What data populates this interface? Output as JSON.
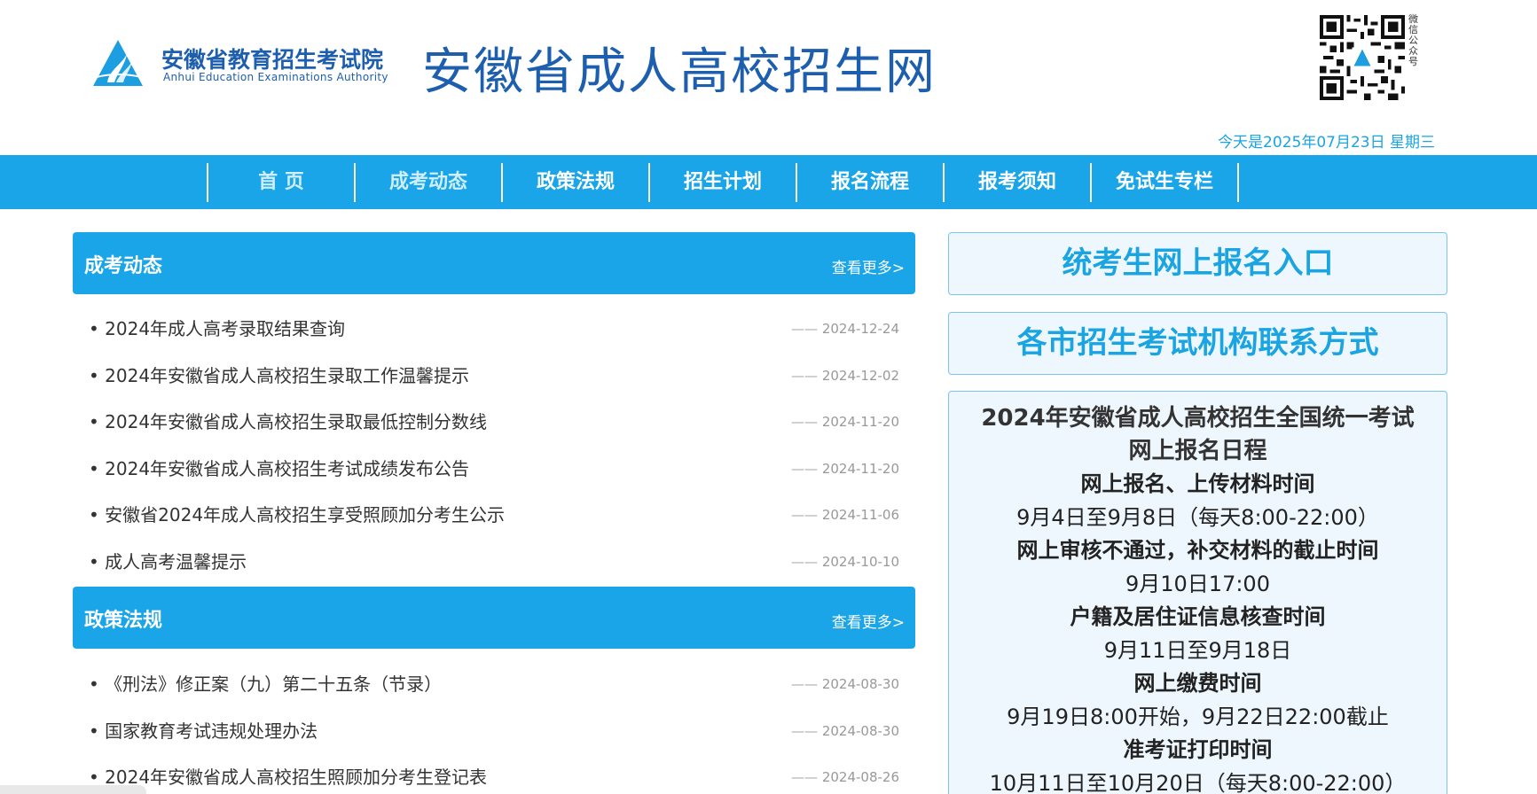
{
  "header": {
    "org_name_cn": "安徽省教育招生考试院",
    "org_name_en": "Anhui Education Examinations Authority",
    "site_title": "安徽省成人高校招生网",
    "qr_label": "微信公众号",
    "date_text": "今天是2025年07月23日 星期三"
  },
  "nav": {
    "items": [
      {
        "label": "首 页"
      },
      {
        "label": "成考动态"
      },
      {
        "label": "政策法规"
      },
      {
        "label": "招生计划"
      },
      {
        "label": "报名流程"
      },
      {
        "label": "报考须知"
      },
      {
        "label": "免试生专栏"
      }
    ]
  },
  "news_section": {
    "title": "成考动态",
    "more": "查看更多>",
    "items": [
      {
        "title": "2024年成人高考录取结果查询",
        "date": "2024-12-24"
      },
      {
        "title": "2024年安徽省成人高校招生录取工作温馨提示",
        "date": "2024-12-02"
      },
      {
        "title": "2024年安徽省成人高校招生录取最低控制分数线",
        "date": "2024-11-20"
      },
      {
        "title": "2024年安徽省成人高校招生考试成绩发布公告",
        "date": "2024-11-20"
      },
      {
        "title": "安徽省2024年成人高校招生享受照顾加分考生公示",
        "date": "2024-11-06"
      },
      {
        "title": "成人高考温馨提示",
        "date": "2024-10-10"
      }
    ]
  },
  "policy_section": {
    "title": "政策法规",
    "more": "查看更多>",
    "items": [
      {
        "title": "《刑法》修正案（九）第二十五条（节录）",
        "date": "2024-08-30"
      },
      {
        "title": "国家教育考试违规处理办法",
        "date": "2024-08-30"
      },
      {
        "title": "2024年安徽省成人高校招生照顾加分考生登记表",
        "date": "2024-08-26"
      }
    ]
  },
  "right": {
    "register_entry": "统考生网上报名入口",
    "contact_entry": "各市招生考试机构联系方式",
    "schedule": {
      "title_line1": "2024年安徽省成人高校招生全国统一考试",
      "title_line2": "网上报名日程",
      "lines": [
        {
          "text": "网上报名、上传材料时间",
          "bold": true
        },
        {
          "text": "9月4日至9月8日（每天8:00-22:00）",
          "bold": false
        },
        {
          "text": "网上审核不通过，补交材料的截止时间",
          "bold": true
        },
        {
          "text": "9月10日17:00",
          "bold": false
        },
        {
          "text": "户籍及居住证信息核查时间",
          "bold": true
        },
        {
          "text": "9月11日至9月18日",
          "bold": false
        },
        {
          "text": "网上缴费时间",
          "bold": true
        },
        {
          "text": "9月19日8:00开始，9月22日22:00截止",
          "bold": false
        },
        {
          "text": "准考证打印时间",
          "bold": true
        },
        {
          "text": "10月11日至10月20日（每天8:00-22:00）",
          "bold": false
        }
      ]
    }
  },
  "colors": {
    "primary": "#1aa5e8",
    "title_blue": "#1d5fae",
    "box_bg": "#eef7fd"
  }
}
